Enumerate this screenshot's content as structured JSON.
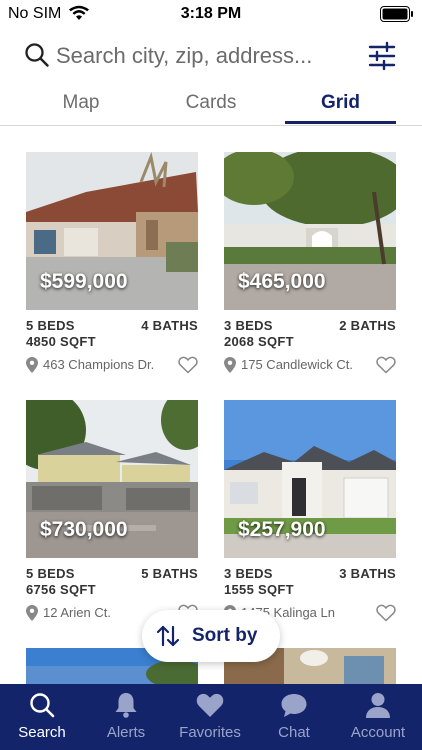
{
  "status_bar": {
    "carrier": "No SIM",
    "time": "3:18 PM"
  },
  "search": {
    "placeholder": "Search city, zip, address..."
  },
  "tabs": [
    {
      "label": "Map",
      "active": false
    },
    {
      "label": "Cards",
      "active": false
    },
    {
      "label": "Grid",
      "active": true
    }
  ],
  "listings": [
    {
      "price": "$599,000",
      "beds": "5 BEDS",
      "baths": "4 BATHS",
      "sqft": "4850 SQFT",
      "address": "463 Champions Dr."
    },
    {
      "price": "$465,000",
      "beds": "3 BEDS",
      "baths": "2 BATHS",
      "sqft": "2068 SQFT",
      "address": "175 Candlewick Ct."
    },
    {
      "price": "$730,000",
      "beds": "5 BEDS",
      "baths": "5 BATHS",
      "sqft": "6756 SQFT",
      "address": "12 Arien Ct."
    },
    {
      "price": "$257,900",
      "beds": "3 BEDS",
      "baths": "3 BATHS",
      "sqft": "1555 SQFT",
      "address": "1475 Kalinga Ln"
    }
  ],
  "sort": {
    "label": "Sort by"
  },
  "nav": [
    {
      "label": "Search",
      "icon": "search-icon",
      "active": true
    },
    {
      "label": "Alerts",
      "icon": "bell-icon",
      "active": false
    },
    {
      "label": "Favorites",
      "icon": "heart-icon",
      "active": false
    },
    {
      "label": "Chat",
      "icon": "chat-bubble-icon",
      "active": false
    },
    {
      "label": "Account",
      "icon": "person-icon",
      "active": false
    }
  ],
  "colors": {
    "brand": "#14246b",
    "nav_inactive": "#9aa3c9"
  }
}
